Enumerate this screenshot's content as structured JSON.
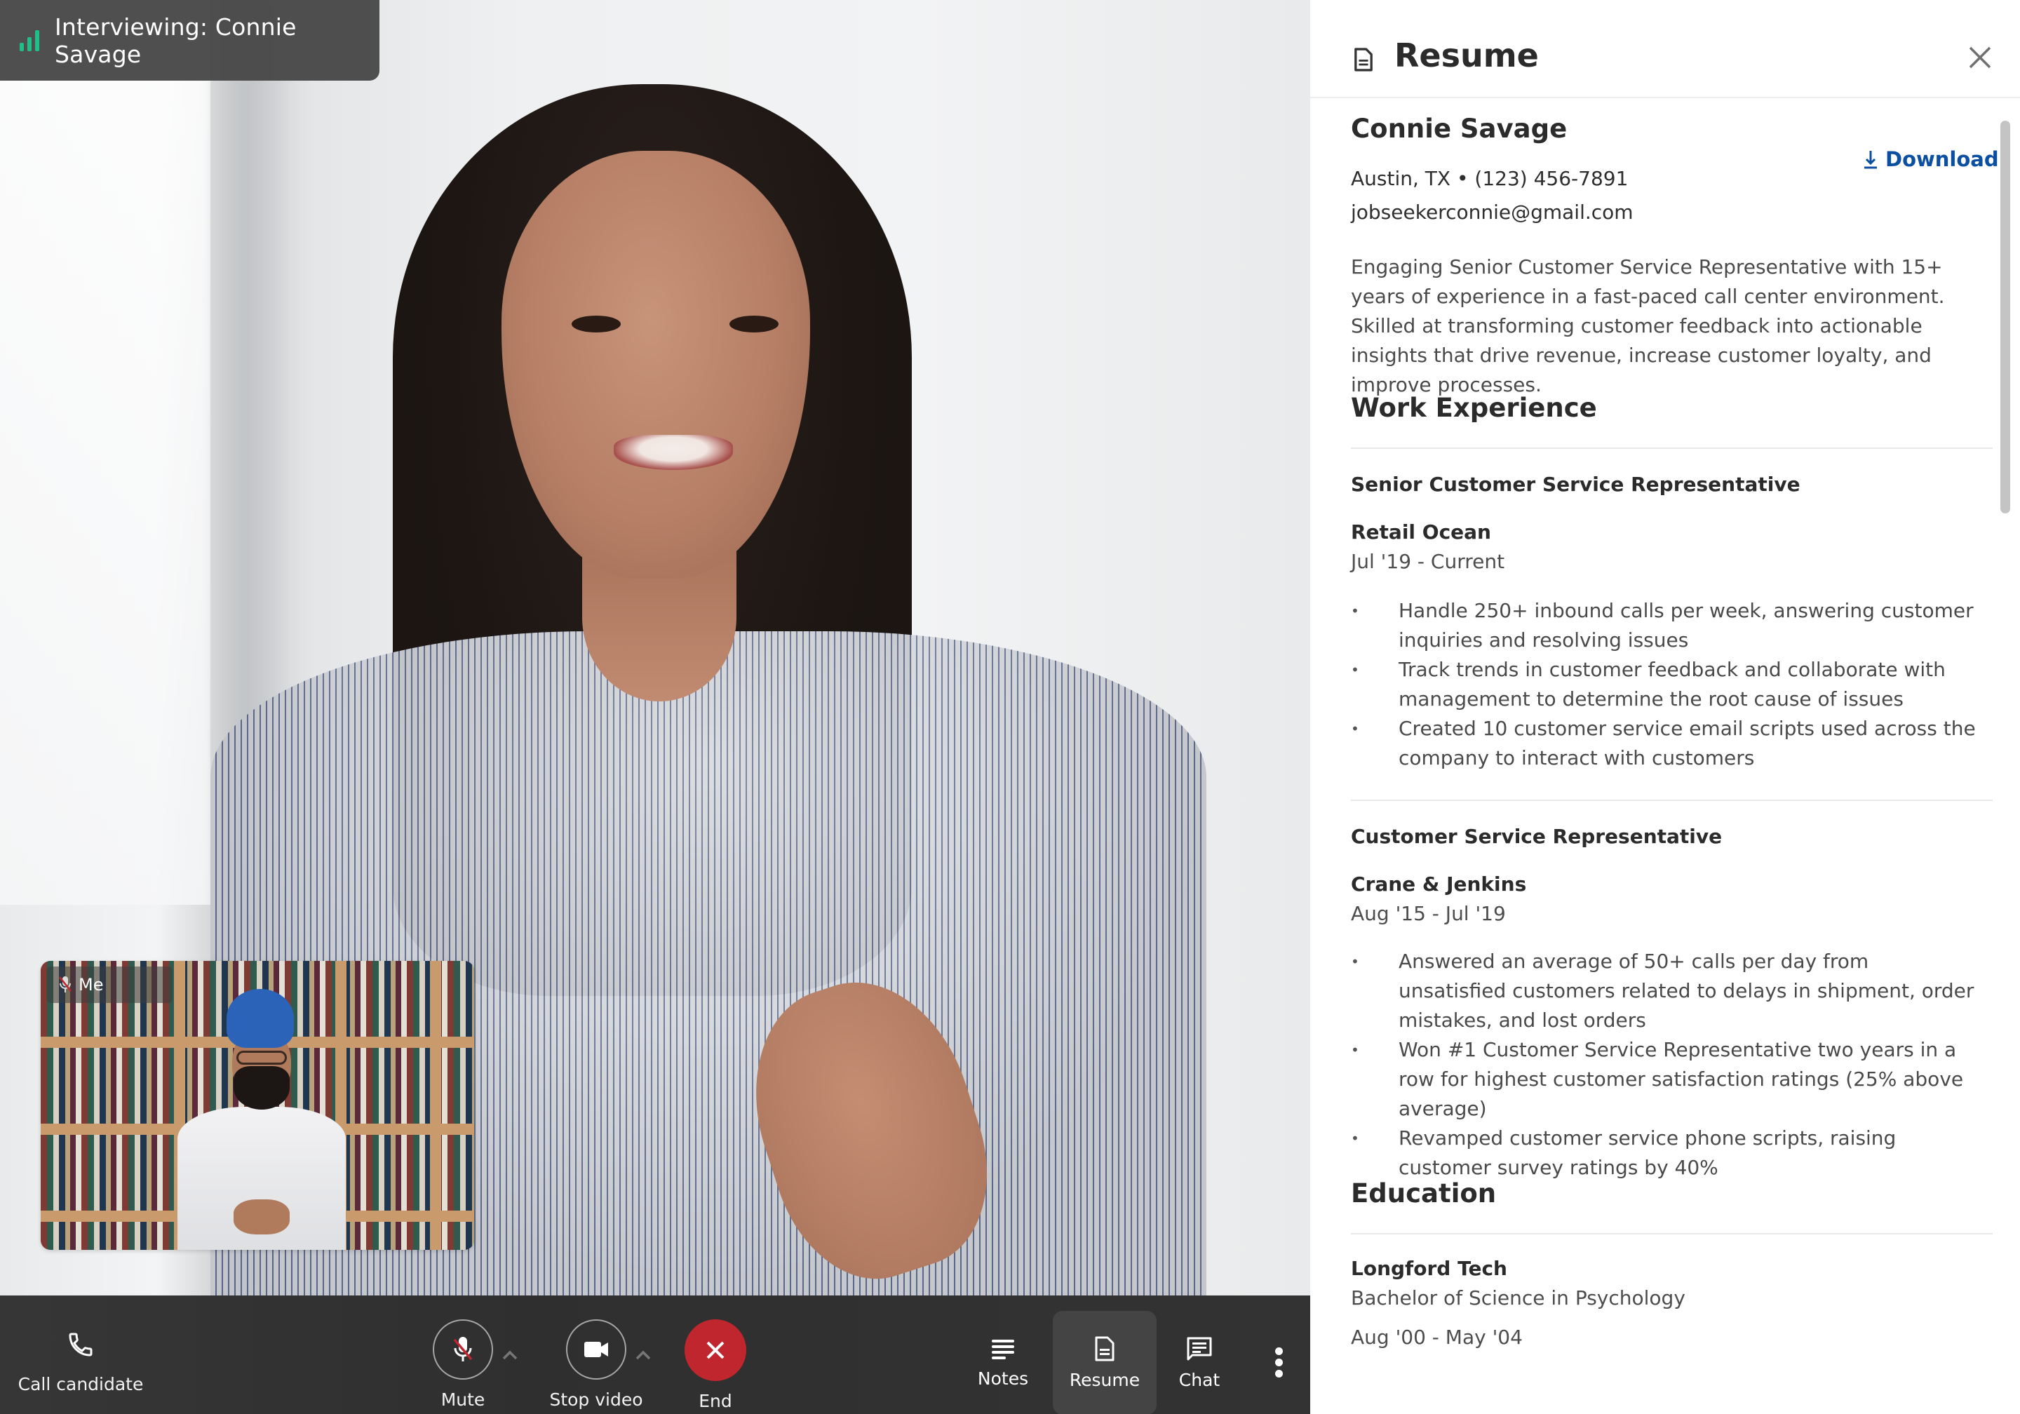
{
  "call": {
    "banner_text": "Interviewing: Connie Savage",
    "signal_color": "#1fbf87",
    "self_view_label": "Me"
  },
  "controls": {
    "call_candidate": "Call candidate",
    "mute": "Mute",
    "stop_video": "Stop video",
    "end": "End",
    "end_color": "#c0262d",
    "notes": "Notes",
    "resume": "Resume",
    "chat": "Chat",
    "active_tool": "Resume"
  },
  "panel": {
    "title": "Resume",
    "download_label": "Download",
    "link_color": "#0b4fa3"
  },
  "resume": {
    "name": "Connie Savage",
    "location_phone": "Austin, TX • (123) 456-7891",
    "email": "jobseekerconnie@gmail.com",
    "summary": "Engaging Senior Customer Service Representative with 15+ years of experience in a fast-paced call center environment. Skilled at trans­forming customer feedback into actionable insights that drive reve­nue, increase customer loyalty, and improve processes.",
    "work_title": "Work Experience",
    "jobs": [
      {
        "role": "Senior Customer Service Representative",
        "company": "Retail Ocean",
        "dates": "Jul '19 - Current",
        "bullets": [
          "Handle 250+ inbound calls per week, answering customer inquiries and resolving issues",
          "Track trends in customer feedback and collaborate with management to determine the root cause of issues",
          "Created 10 customer service email scripts used across the company to interact with customers"
        ]
      },
      {
        "role": "Customer Service Representative",
        "company": "Crane & Jenkins",
        "dates": "Aug '15 - Jul '19",
        "bullets": [
          "Answered an average of 50+ calls per day from unsatisfied customers related to delays in shipment, order mistakes, and lost orders",
          "Won #1 Customer Service Representative two years in a row for highest customer satisfaction ratings (25% above average)",
          "Revamped customer service phone scripts, raising customer survey ratings by 40%"
        ]
      }
    ],
    "education_title": "Education",
    "education": {
      "school": "Longford Tech",
      "degree": "Bachelor of Science in Psychology",
      "dates": "Aug '00 - May '04"
    }
  }
}
